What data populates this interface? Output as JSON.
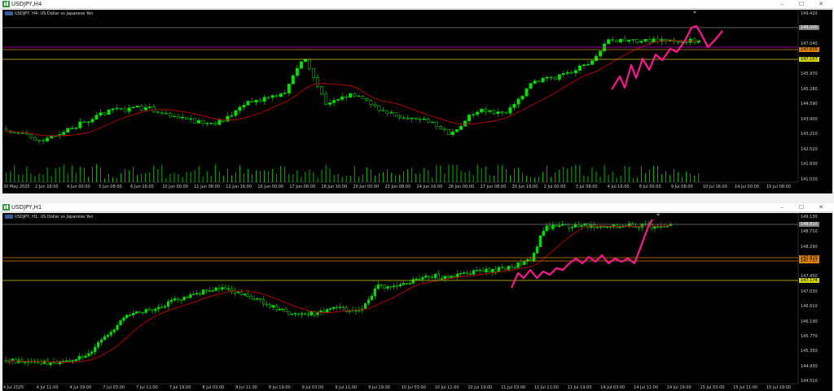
{
  "colors": {
    "bull": "#00e000",
    "bear": "#000000",
    "bear_outline": "#00e000",
    "ma": "#c00000",
    "line_yellow": "#d4d400",
    "line_magenta": "#c000c0",
    "line_gray": "#808080",
    "line_orange": "#e08000",
    "draw_pink": "#ff1493"
  },
  "top": {
    "title": "USDJPY,H4",
    "info": "USDJPY, H4:  US Dollar vs Japanese Yen",
    "buttons": [
      "–",
      "☐",
      "✕"
    ],
    "prices": [
      "149.420",
      "148.060",
      "147.040",
      "146.660",
      "145.970",
      "145.280",
      "144.590",
      "143.900",
      "143.210",
      "142.520",
      "141.830",
      "141.020"
    ],
    "badges": [
      {
        "text": "148.000",
        "bg": "#808080",
        "fg": "#ffffff"
      },
      {
        "text": "147.835",
        "bg": "#e08000",
        "fg": "#000000"
      },
      {
        "text": "147.157",
        "bg": "#d4d400",
        "fg": "#000000"
      }
    ],
    "times": [
      "30 May 2025",
      "2 Jun 16:00",
      "4 Jun 00:00",
      "5 Jun 08:00",
      "6 Jun 16:00",
      "10 Jun 00:00",
      "11 Jun 08:00",
      "12 Jun 16:00",
      "16 Jun 00:00",
      "17 Jun 08:00",
      "18 Jun 16:00",
      "20 Jun 00:00",
      "23 Jun 08:00",
      "24 Jun 16:00",
      "26 Jun 00:00",
      "27 Jun 08:00",
      "30 Jun 16:00",
      "2 Jul 00:00",
      "3 Jul 08:00",
      "4 Jul 16:00",
      "8 Jul 00:00",
      "9 Jul 08:00",
      "10 Jul 16:00",
      "14 Jul 00:00",
      "15 Jul 08:00"
    ]
  },
  "bottom": {
    "title": "USDJPY,H1",
    "info": "USDJPY, H1:  US Dollar vs Japanese Yen",
    "buttons": [
      "–",
      "☐",
      "✕"
    ],
    "prices": [
      "149.130",
      "148.710",
      "148.290",
      "147.870",
      "147.450",
      "147.030",
      "146.610",
      "146.190",
      "145.770",
      "145.350",
      "144.930",
      "144.510"
    ],
    "badges": [
      {
        "text": "148.810",
        "bg": "#808080",
        "fg": "#ffffff"
      },
      {
        "text": "147.870",
        "bg": "#e08000",
        "fg": "#000000"
      },
      {
        "text": "147.737",
        "bg": "#e08000",
        "fg": "#000000"
      },
      {
        "text": "147.174",
        "bg": "#d4d400",
        "fg": "#000000"
      }
    ],
    "times": [
      "4 Jul 2025",
      "4 Jul 11:00",
      "4 Jul 19:00",
      "7 Jul 03:00",
      "7 Jul 11:00",
      "7 Jul 19:00",
      "8 Jul 03:00",
      "8 Jul 11:00",
      "8 Jul 19:00",
      "9 Jul 03:00",
      "9 Jul 11:00",
      "9 Jul 19:00",
      "10 Jul 03:00",
      "10 Jul 11:00",
      "10 Jul 19:00",
      "11 Jul 03:00",
      "11 Jul 11:00",
      "11 Jul 19:00",
      "14 Jul 03:00",
      "14 Jul 11:00",
      "14 Jul 19:00",
      "15 Jul 03:00",
      "15 Jul 11:00",
      "15 Jul 19:00"
    ]
  }
}
